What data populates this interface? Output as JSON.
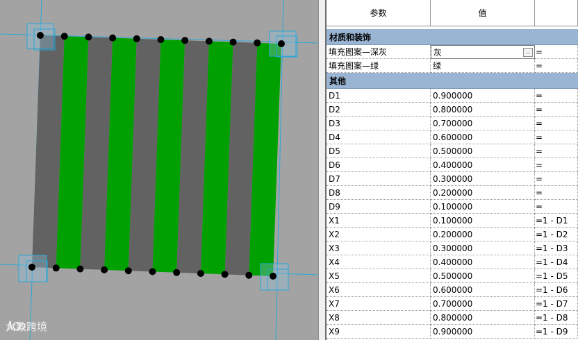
{
  "watermark": {
    "text": "大数跨境"
  },
  "viewport": {
    "colors": {
      "background": "#a3a3a3",
      "dark_gray": "#626262",
      "green": "#00a000",
      "guide": "#2aa8d8",
      "grip": "#000000"
    },
    "stripes": [
      "dark_gray",
      "green",
      "dark_gray",
      "green",
      "dark_gray",
      "green",
      "dark_gray",
      "green",
      "dark_gray",
      "green"
    ]
  },
  "panel": {
    "headers": {
      "param": "参数",
      "value": "值",
      "formula": ""
    },
    "groups": [
      {
        "title": "材质和装饰",
        "rows": [
          {
            "name": "填充图案—深灰",
            "value": "灰",
            "formula": "="
          },
          {
            "name": "填充图案—绿",
            "value": "绿",
            "formula": "="
          }
        ]
      },
      {
        "title": "其他",
        "rows": [
          {
            "name": "D1",
            "value": "0.900000",
            "formula": "="
          },
          {
            "name": "D2",
            "value": "0.800000",
            "formula": "="
          },
          {
            "name": "D3",
            "value": "0.700000",
            "formula": "="
          },
          {
            "name": "D4",
            "value": "0.600000",
            "formula": "="
          },
          {
            "name": "D5",
            "value": "0.500000",
            "formula": "="
          },
          {
            "name": "D6",
            "value": "0.400000",
            "formula": "="
          },
          {
            "name": "D7",
            "value": "0.300000",
            "formula": "="
          },
          {
            "name": "D8",
            "value": "0.200000",
            "formula": "="
          },
          {
            "name": "D9",
            "value": "0.100000",
            "formula": "="
          },
          {
            "name": "X1",
            "value": "0.100000",
            "formula": "=1 - D1"
          },
          {
            "name": "X2",
            "value": "0.200000",
            "formula": "=1 - D2"
          },
          {
            "name": "X3",
            "value": "0.300000",
            "formula": "=1 - D3"
          },
          {
            "name": "X4",
            "value": "0.400000",
            "formula": "=1 - D4"
          },
          {
            "name": "X5",
            "value": "0.500000",
            "formula": "=1 - D5"
          },
          {
            "name": "X6",
            "value": "0.600000",
            "formula": "=1 - D6"
          },
          {
            "name": "X7",
            "value": "0.700000",
            "formula": "=1 - D7"
          },
          {
            "name": "X8",
            "value": "0.800000",
            "formula": "=1 - D8"
          },
          {
            "name": "X9",
            "value": "0.900000",
            "formula": "=1 - D9"
          }
        ]
      }
    ],
    "browse_button": "..."
  }
}
